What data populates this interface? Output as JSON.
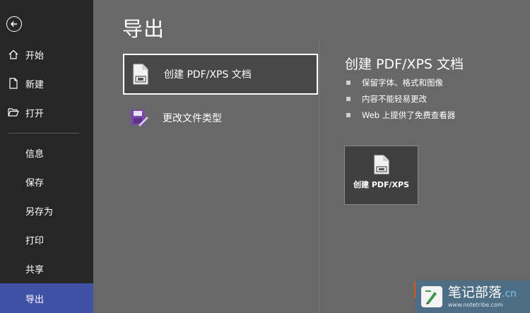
{
  "sidebar": {
    "items": [
      {
        "label": "开始",
        "icon": "home-icon"
      },
      {
        "label": "新建",
        "icon": "new-document-icon"
      },
      {
        "label": "打开",
        "icon": "open-folder-icon"
      },
      {
        "label": "信息"
      },
      {
        "label": "保存"
      },
      {
        "label": "另存为"
      },
      {
        "label": "打印"
      },
      {
        "label": "共享"
      },
      {
        "label": "导出",
        "active": true
      }
    ]
  },
  "main": {
    "title": "导出",
    "options": [
      {
        "label": "创建 PDF/XPS 文档",
        "selected": true,
        "icon": "pdf-document-icon"
      },
      {
        "label": "更改文件类型",
        "icon": "change-file-type-icon"
      }
    ],
    "detail": {
      "title": "创建 PDF/XPS 文档",
      "bullets": [
        "保留字体、格式和图像",
        "内容不能轻易更改",
        "Web 上提供了免费查看器"
      ],
      "button_label": "创建 PDF/XPS"
    }
  },
  "watermark": {
    "title": "笔记部落",
    "suffix": ".cn",
    "url": "www.notetribe.com"
  },
  "colors": {
    "sidebar_bg": "#262626",
    "active_nav": "#3f52a6",
    "main_bg": "#686868",
    "selected_option_bg": "#484848"
  }
}
